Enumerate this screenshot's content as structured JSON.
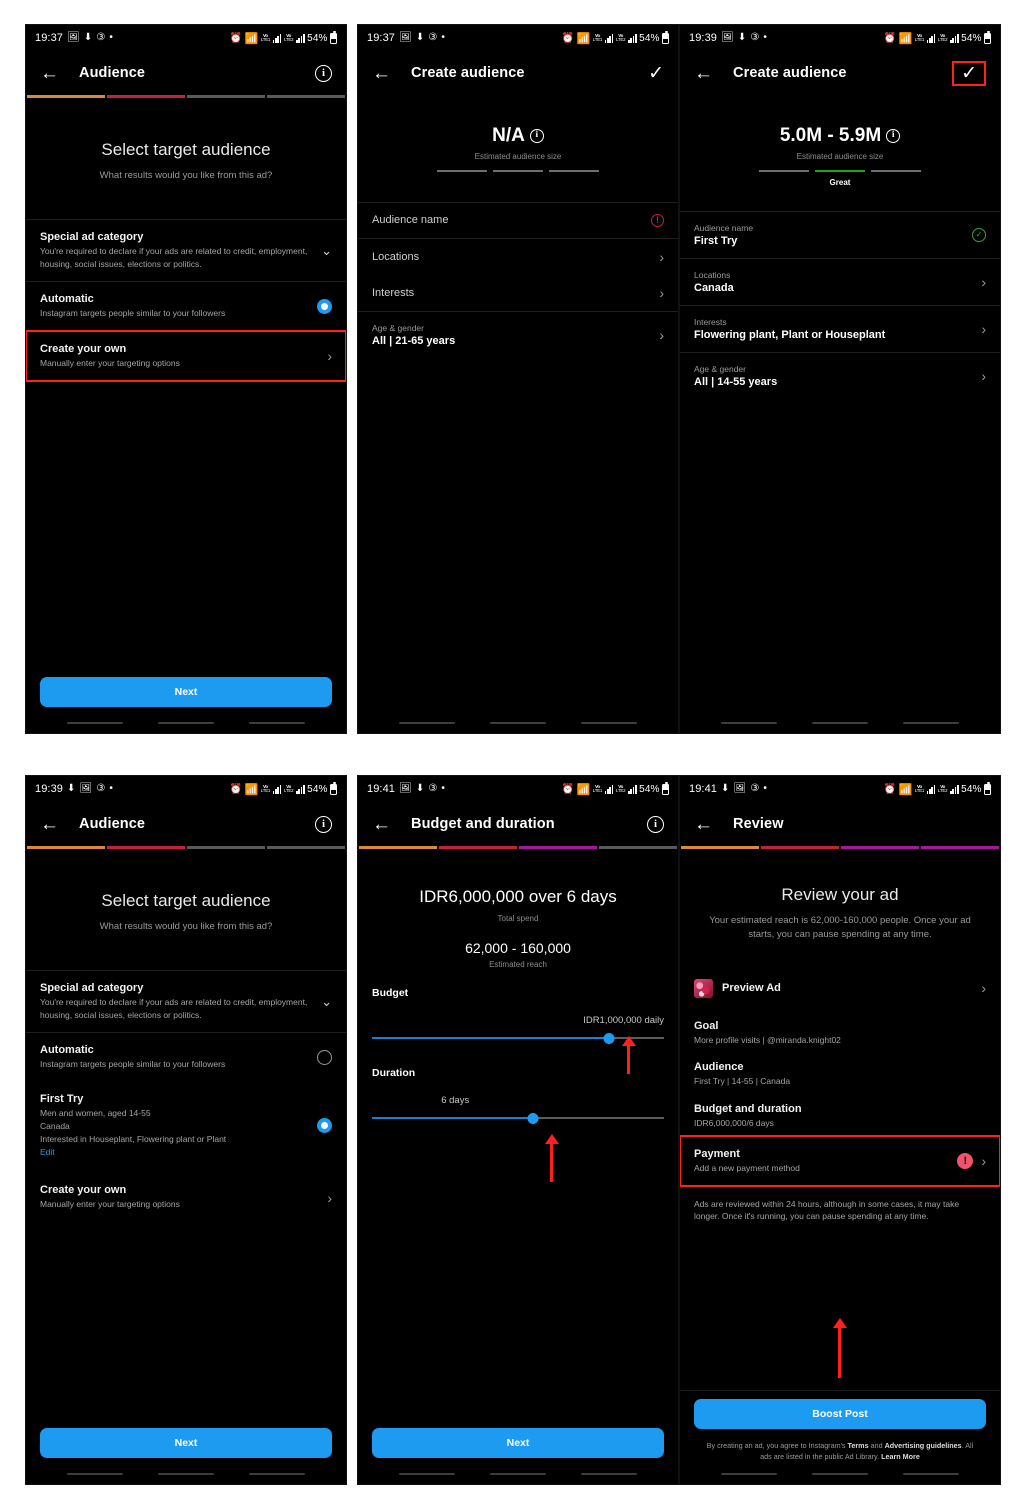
{
  "status_bar": {
    "time_a": "19:37",
    "time_b": "19:39",
    "time_c": "19:41",
    "battery": "54%",
    "icons": [
      "photo-icon",
      "download-icon",
      "badge-icon",
      "dot-icon",
      "alarm-icon",
      "wifi-icon",
      "signal-icon"
    ],
    "volte_label_1": "Vo",
    "volte_label_2": "LTE1",
    "volte_label_3": "LTE2"
  },
  "colors": {
    "accent_blue": "#1d9bf0",
    "highlight_red": "#ff2020",
    "arrow_red": "#ff1f1f",
    "good_green": "#21a121",
    "alert_pink": "#f0536b",
    "seg_orange": "#d98b3a",
    "seg_crimson": "#c4213c",
    "seg_magenta": "#a3199a",
    "seg_inactive": "#5a5a5a"
  },
  "panel1": {
    "title": "Audience",
    "back_icon": "back-arrow-icon",
    "action_icon": "info-icon",
    "progress": [
      "orange",
      "crimson",
      "gray",
      "gray"
    ],
    "hero_title": "Select target audience",
    "hero_sub": "What results would you like from this ad?",
    "rows": [
      {
        "title": "Special ad category",
        "desc": "You're required to declare if your ads are related to credit, employment, housing, social issues, elections or politics.",
        "control": "caret"
      },
      {
        "title": "Automatic",
        "desc": "Instagram targets people similar to your followers",
        "control": "radio-on"
      },
      {
        "title": "Create your own",
        "desc": "Manually enter your targeting options",
        "control": "chevron",
        "highlighted": true
      }
    ],
    "cta": "Next"
  },
  "panel2": {
    "title": "Create audience",
    "back_icon": "back-arrow-icon",
    "action_icon": "check-icon",
    "estimate_value": "N/A",
    "estimate_label": "Estimated audience size",
    "gauge_active": -1,
    "gauge_text": "",
    "rows": [
      {
        "label": "Audience name",
        "value": "",
        "control": "warn"
      },
      {
        "label": "Locations",
        "value": "",
        "control": "chevron"
      },
      {
        "label": "Interests",
        "value": "",
        "control": "chevron"
      },
      {
        "label": "Age & gender",
        "value": "All | 21-65 years",
        "control": "chevron"
      }
    ]
  },
  "panel3": {
    "title": "Create audience",
    "back_icon": "back-arrow-icon",
    "action_icon": "check-icon",
    "action_highlighted": true,
    "estimate_value": "5.0M - 5.9M",
    "estimate_label": "Estimated audience size",
    "gauge_active": 1,
    "gauge_text": "Great",
    "rows": [
      {
        "label": "Audience name",
        "value": "First Try",
        "control": "ok"
      },
      {
        "label": "Locations",
        "value": "Canada",
        "control": "chevron"
      },
      {
        "label": "Interests",
        "value": "Flowering plant, Plant or Houseplant",
        "control": "chevron"
      },
      {
        "label": "Age & gender",
        "value": "All | 14-55 years",
        "control": "chevron"
      }
    ]
  },
  "panel4": {
    "title": "Audience",
    "back_icon": "back-arrow-icon",
    "action_icon": "info-icon",
    "progress": [
      "orange",
      "crimson",
      "gray",
      "gray"
    ],
    "hero_title": "Select target audience",
    "hero_sub": "What results would you like from this ad?",
    "rows": [
      {
        "title": "Special ad category",
        "desc": "You're required to declare if your ads are related to credit, employment, housing, social issues, elections or politics.",
        "control": "caret"
      },
      {
        "title": "Automatic",
        "desc": "Instagram targets people similar to your followers",
        "control": "radio-off"
      },
      {
        "title": "First Try",
        "desc": "Men and women, aged 14-55\nCanada\nInterested in Houseplant, Flowering plant or Plant",
        "edit": "Edit",
        "control": "radio-on"
      },
      {
        "title": "Create your own",
        "desc": "Manually enter your targeting options",
        "control": "chevron"
      }
    ],
    "cta": "Next"
  },
  "panel5": {
    "title": "Budget and duration",
    "back_icon": "back-arrow-icon",
    "action_icon": "info-icon",
    "progress": [
      "orange",
      "crimson",
      "magenta",
      "gray"
    ],
    "total_spend_value": "IDR6,000,000 over 6 days",
    "total_spend_label": "Total spend",
    "reach_value": "62,000 - 160,000",
    "reach_label": "Estimated reach",
    "budget_section": "Budget",
    "budget_value": "IDR1,000,000 daily",
    "budget_percent": 81,
    "duration_section": "Duration",
    "duration_value": "6 days",
    "duration_percent": 55,
    "cta": "Next"
  },
  "panel6": {
    "title": "Review",
    "back_icon": "back-arrow-icon",
    "progress": [
      "orange",
      "crimson",
      "magenta",
      "magenta"
    ],
    "hero_title": "Review your ad",
    "hero_sub": "Your estimated reach is 62,000-160,000 people. Once your ad starts, you can pause spending at any time.",
    "preview_label": "Preview Ad",
    "rows": [
      {
        "label": "Goal",
        "value": "More profile visits | @miranda.knight02"
      },
      {
        "label": "Audience",
        "value": "First Try | 14-55 | Canada"
      },
      {
        "label": "Budget and duration",
        "value": "IDR6,000,000/6 days"
      },
      {
        "label": "Payment",
        "value": "Add a new payment method",
        "control": "alert",
        "highlighted": true
      }
    ],
    "note": "Ads are reviewed within 24 hours, although in some cases, it may take longer. Once it's running, you can pause spending at any time.",
    "cta": "Boost Post",
    "legal_1": "By creating an ad, you agree to Instagram's ",
    "legal_b1": "Terms",
    "legal_2": " and ",
    "legal_b2": "Advertising guidelines",
    "legal_3": ". All ads are listed in the public Ad Library. ",
    "legal_b3": "Learn More"
  }
}
